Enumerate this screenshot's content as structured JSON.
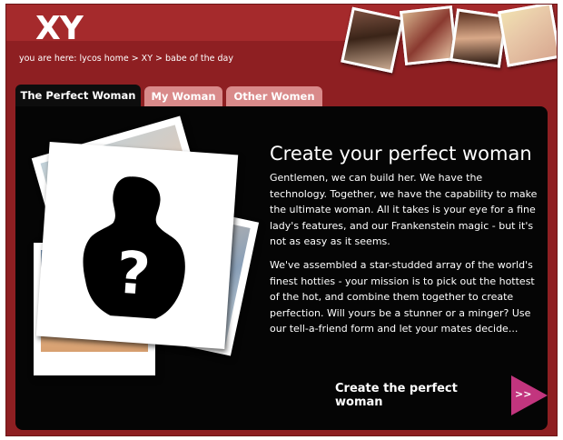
{
  "header": {
    "logo": "XY",
    "breadcrumb": "you are here: lycos home > XY > babe of the day"
  },
  "tabs": [
    {
      "label": "The Perfect Woman",
      "active": true
    },
    {
      "label": "My Woman",
      "active": false
    },
    {
      "label": "Other Women",
      "active": false
    }
  ],
  "main": {
    "heading": "Create your perfect woman",
    "paragraph1": "Gentlemen, we can build her. We have the technology. Together, we have the capability to make the ultimate woman. All it takes is your eye for a fine lady's features, and our Frankenstein magic - but it's not as easy as it seems.",
    "paragraph2": "We've assembled a star-studded array of the world's finest hotties - your mission is to pick out the hottest of the hot, and combine them together to create perfection. Will yours be a stunner or a minger? Use our tell-a-friend form and let your mates decide...",
    "cta_label": "Create the perfect woman",
    "cta_arrow": ">>",
    "silhouette_mark": "?"
  },
  "colors": {
    "brand_red": "#8e1f22",
    "header_red": "#a52a2c",
    "panel": "#050505",
    "inactive_tab": "#d98a8a",
    "cta_arrow": "#c2357e"
  }
}
